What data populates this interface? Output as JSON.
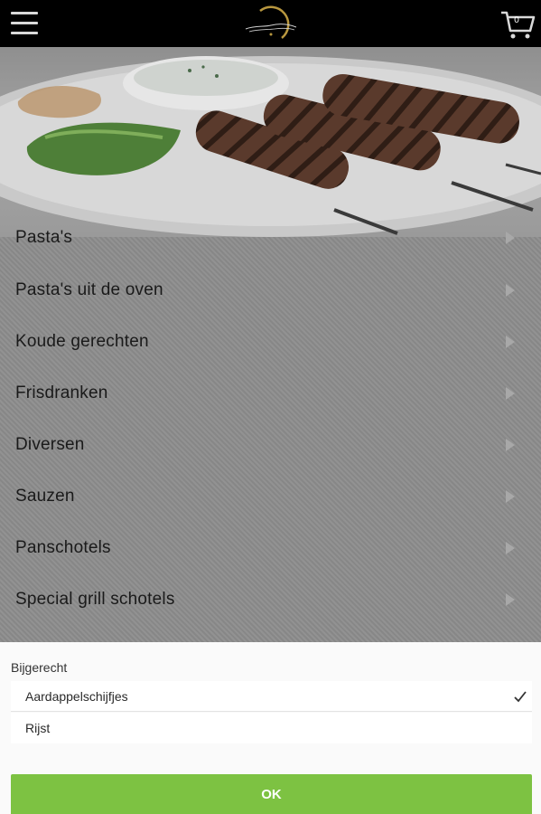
{
  "header": {
    "menu_icon": "hamburger-menu-icon",
    "logo_icon": "restaurant-logo",
    "cart_icon": "shopping-cart-icon",
    "cart_count": "0"
  },
  "hero": {
    "image": "kebab-skewers-on-plate-photo"
  },
  "menu": {
    "items": [
      {
        "label": "Pasta's"
      },
      {
        "label": "Pasta's uit de oven"
      },
      {
        "label": "Koude gerechten"
      },
      {
        "label": "Frisdranken"
      },
      {
        "label": "Diversen"
      },
      {
        "label": "Sauzen"
      },
      {
        "label": "Panschotels"
      },
      {
        "label": "Special grill schotels"
      }
    ]
  },
  "sheet": {
    "title": "Bijgerecht",
    "options": [
      {
        "label": "Aardappelschijfjes",
        "selected": true
      },
      {
        "label": "Rijst",
        "selected": false
      }
    ],
    "ok_label": "OK"
  },
  "colors": {
    "accent": "#7dc242",
    "topbar": "#000000"
  }
}
